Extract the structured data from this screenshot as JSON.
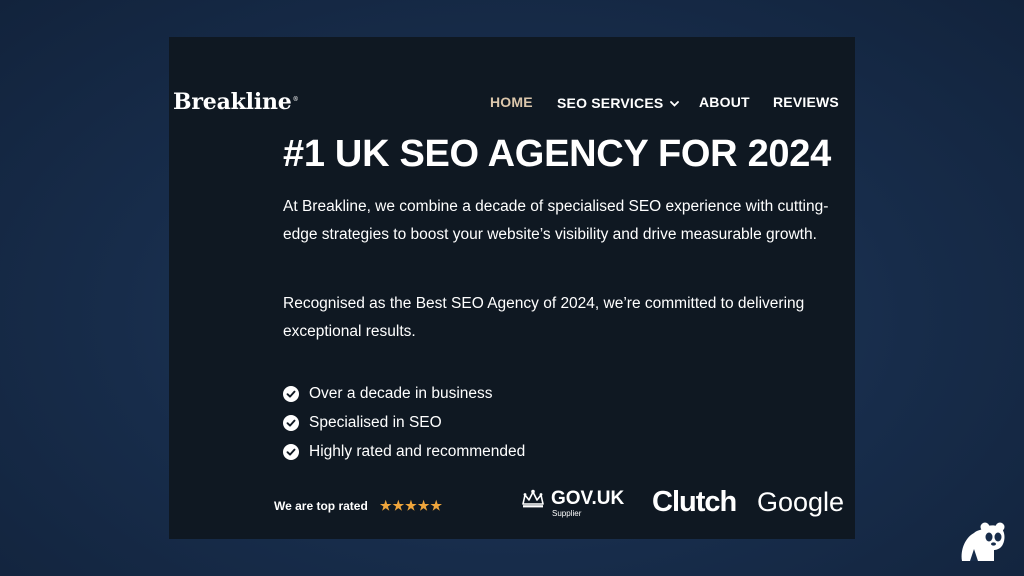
{
  "header": {
    "logo": "Breakline",
    "logo_mark": "®",
    "nav": [
      {
        "label": "HOME",
        "active": true
      },
      {
        "label": "SEO SERVICES",
        "active": false,
        "has_dropdown": true
      },
      {
        "label": "ABOUT",
        "active": false
      },
      {
        "label": "REVIEWS",
        "active": false
      }
    ]
  },
  "hero": {
    "title": "#1 UK SEO AGENCY FOR 2024",
    "paragraphs": [
      "At Breakline, we combine a decade of specialised SEO experience with cutting-edge strategies to boost your website’s visibility and drive measurable growth.",
      "Recognised as the Best SEO Agency of 2024, we’re committed to delivering exceptional results."
    ],
    "checklist": [
      "Over a decade in business",
      "Specialised in SEO",
      "Highly rated and recommended"
    ]
  },
  "trust": {
    "rated_label": "We are top rated",
    "stars": "★★★★★",
    "gov_name": "GOV.UK",
    "gov_sub": "Supplier",
    "clutch": "Clutch",
    "google": "Google"
  },
  "colors": {
    "background": "#172c4a",
    "panel": "#0f1822",
    "nav_active": "#dcc7ac",
    "star": "#f0a63c",
    "text": "#ffffff"
  },
  "icons": {
    "checklist": "check-circle-icon",
    "dropdown": "chevron-down-icon",
    "gov": "crown-icon",
    "corner": "panda-icon"
  }
}
